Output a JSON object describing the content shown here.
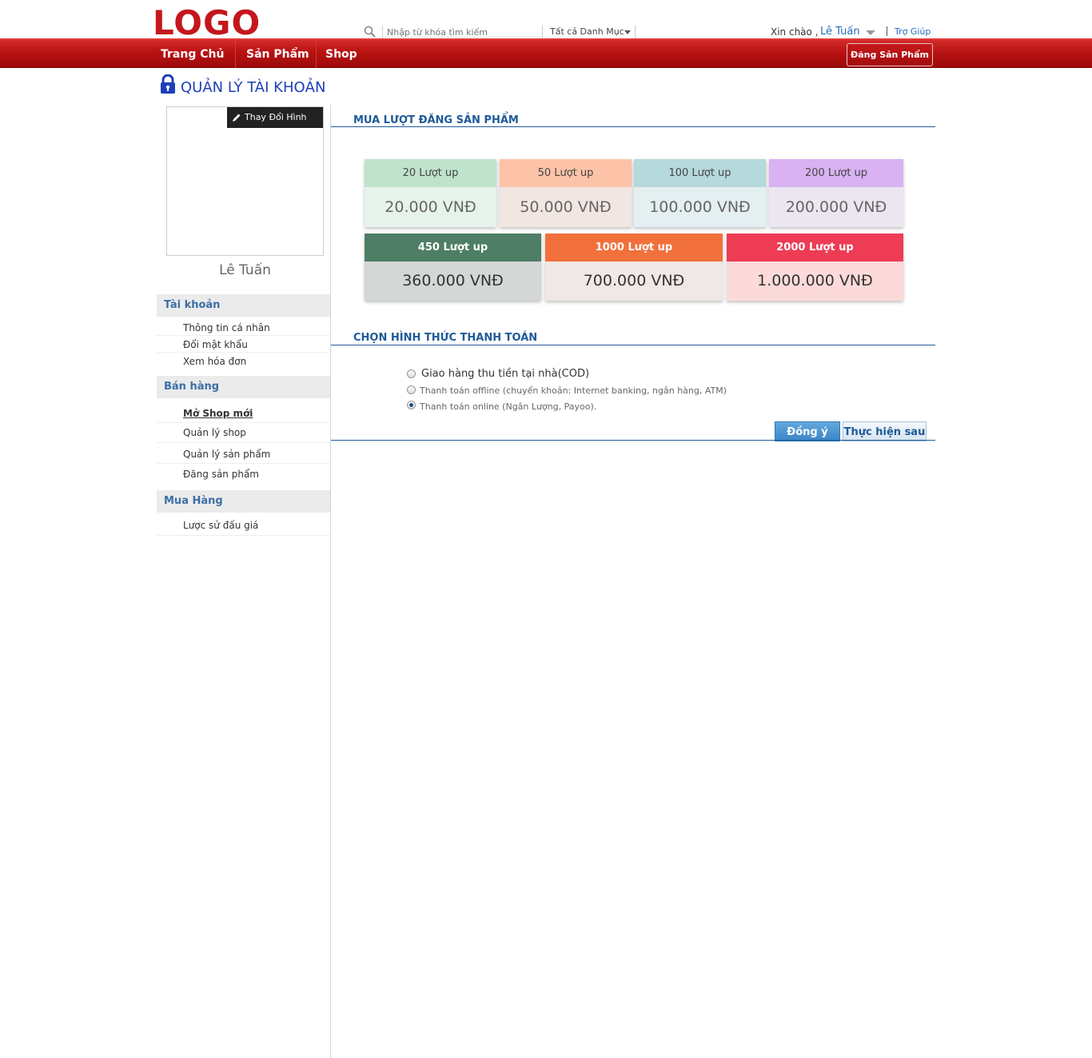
{
  "header": {
    "logo": "LOGO",
    "search_placeholder": "Nhập từ khóa tìm kiếm",
    "category": "Tất cả Danh Mục",
    "greeting": "Xin chào ,",
    "user": "Lê Tuấn",
    "help": "Trợ Giúp"
  },
  "nav": {
    "items": [
      "Trang Chủ",
      "Sản Phẩm",
      "Shop"
    ],
    "post_button": "Đăng Sản Phẩm"
  },
  "page_title": "QUẢN LÝ TÀI KHOẢN",
  "profile": {
    "change_photo": "Thay Đổi Hình Ảnh",
    "name": "Lê Tuấn"
  },
  "sidebar": {
    "groups": [
      {
        "title": "Tài khoản",
        "items": [
          "Thông tin cá nhân",
          "Đổi mật khẩu",
          "Xem hóa đơn"
        ]
      },
      {
        "title": "Bán hàng",
        "items": [
          "Mở Shop mới",
          "Quản lý shop",
          "Quản lý sản phẩm",
          "Đăng sản phẩm"
        ]
      },
      {
        "title": "Mua Hàng",
        "items": [
          "Lược sử đấu giá"
        ]
      }
    ],
    "active_item": "Mở Shop mới"
  },
  "buy_section": {
    "title": "MUA LƯỢT ĐĂNG SẢN PHẨM",
    "packages": [
      {
        "label": "20 Lượt up",
        "price": "20.000 VNĐ",
        "head_color": "#bfe3cc",
        "body_color": "#e6f3ea"
      },
      {
        "label": "50 Lượt up",
        "price": "50.000 VNĐ",
        "head_color": "#fcc3a8",
        "body_color": "#f2e6e2"
      },
      {
        "label": "100 Lượt up",
        "price": "100.000 VNĐ",
        "head_color": "#b5d9dc",
        "body_color": "#e4eff1"
      },
      {
        "label": "200 Lượt up",
        "price": "200.000 VNĐ",
        "head_color": "#d8b2f2",
        "body_color": "#ece6f0"
      },
      {
        "label": "450 Lượt up",
        "price": "360.000 VNĐ",
        "head_color": "#4e7e65",
        "body_color": "#d3d7d5"
      },
      {
        "label": "1000 Lượt up",
        "price": "700.000 VNĐ",
        "head_color": "#f2703c",
        "body_color": "#f0e8e6"
      },
      {
        "label": "2000 Lượt up",
        "price": "1.000.000 VNĐ",
        "head_color": "#ee3c55",
        "body_color": "#fcdada"
      }
    ]
  },
  "payment": {
    "title": "CHỌN HÌNH THỨC THANH TOÁN",
    "options": [
      {
        "label": "Giao hàng thu tiền tại nhà(COD)",
        "checked": false
      },
      {
        "label": "Thanh toán offline (chuyển khoản: Internet banking, ngân hàng, ATM)",
        "checked": false
      },
      {
        "label": "Thanh toán online (Ngân Lượng, Payoo).",
        "checked": true
      }
    ],
    "confirm": "Đồng ý",
    "later": "Thực hiện sau"
  }
}
